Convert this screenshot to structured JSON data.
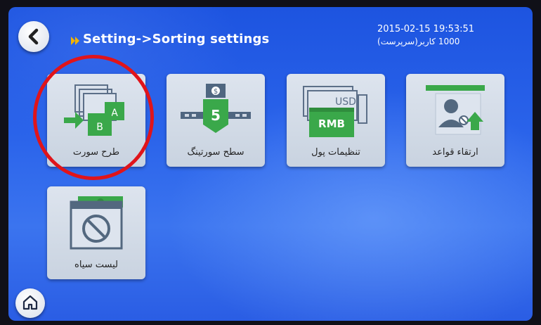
{
  "header": {
    "breadcrumb": "Setting->Sorting settings",
    "datetime": "2015-02-15  19:53:51",
    "user": "(سرپرست)1000  کاربر"
  },
  "tiles": [
    {
      "label": "طرح سورت",
      "icon": "sort-pattern-icon",
      "letters": [
        "A",
        "B"
      ]
    },
    {
      "label": "سطح سورتینگ",
      "icon": "sorting-level-icon",
      "value": "5"
    },
    {
      "label": "تنظیمات پول",
      "icon": "currency-settings-icon",
      "top_text": "USD",
      "front_text": "RMB"
    },
    {
      "label": "ارتقاء قواعد",
      "icon": "upgrade-rules-icon"
    },
    {
      "label": "لیست سیاه",
      "icon": "blacklist-icon"
    }
  ],
  "colors": {
    "accent_green": "#3aa84a",
    "annotation_red": "#e0141a",
    "background_blue": "#2a63ea"
  }
}
